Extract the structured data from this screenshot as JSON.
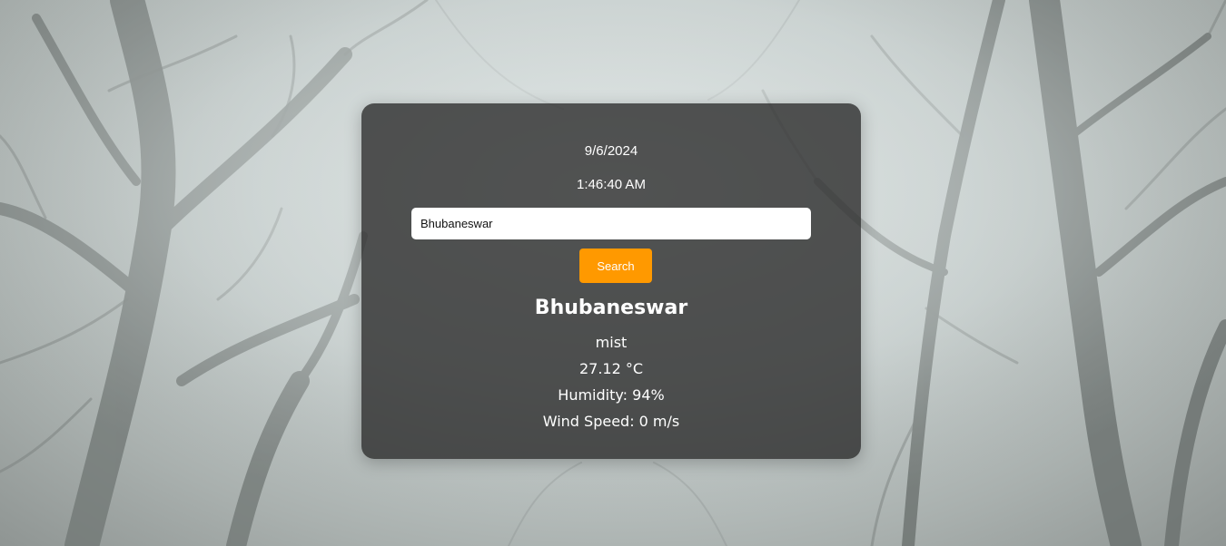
{
  "weather_card": {
    "date": "9/6/2024",
    "time": "1:46:40 AM",
    "search": {
      "value": "Bhubaneswar",
      "button_label": "Search"
    },
    "city": "Bhubaneswar",
    "description": "mist",
    "temperature": "27.12 °C",
    "humidity": "Humidity: 94%",
    "wind_speed": "Wind Speed: 0 m/s"
  },
  "colors": {
    "button": "#ff9900",
    "card_background": "rgba(40,40,40,0.78)",
    "text": "#ffffff"
  },
  "background": {
    "icon": "foggy-forest-background"
  }
}
